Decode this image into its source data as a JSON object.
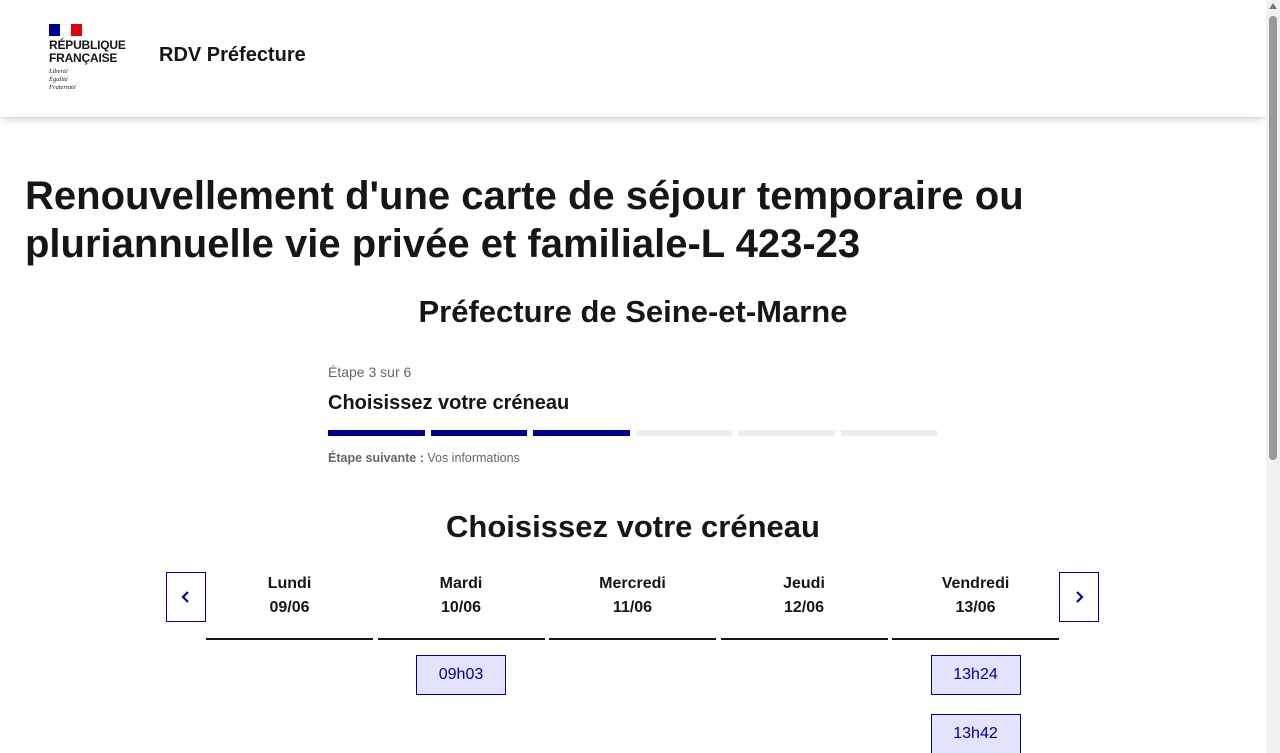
{
  "header": {
    "logo_text_line1": "RÉPUBLIQUE",
    "logo_text_line2": "FRANÇAISE",
    "devise_1": "Liberté",
    "devise_2": "Égalité",
    "devise_3": "Fraternité",
    "service_title": "RDV Préfecture"
  },
  "page": {
    "title": "Renouvellement d'une carte de séjour temporaire ou pluriannuelle vie privée et familiale-L 423-23",
    "prefecture": "Préfecture de Seine-et-Marne"
  },
  "stepper": {
    "state": "Étape 3 sur 6",
    "title": "Choisissez votre créneau",
    "current_step": 3,
    "total_steps": 6,
    "next_label": "Étape suivante :",
    "next_value": "Vos informations"
  },
  "calendar": {
    "section_title": "Choisissez votre créneau",
    "prev_icon": "chevron-left-icon",
    "next_icon": "chevron-right-icon",
    "days": [
      {
        "name": "Lundi",
        "date": "09/06",
        "slots": []
      },
      {
        "name": "Mardi",
        "date": "10/06",
        "slots": [
          "09h03"
        ]
      },
      {
        "name": "Mercredi",
        "date": "11/06",
        "slots": []
      },
      {
        "name": "Jeudi",
        "date": "12/06",
        "slots": []
      },
      {
        "name": "Vendredi",
        "date": "13/06",
        "slots": [
          "13h24",
          "13h42"
        ]
      }
    ]
  },
  "colors": {
    "primary": "#000091",
    "slot_background": "#e3e3fd",
    "flag_blue": "#000091",
    "flag_red": "#e1000f",
    "inactive_step": "#eeeeee"
  }
}
